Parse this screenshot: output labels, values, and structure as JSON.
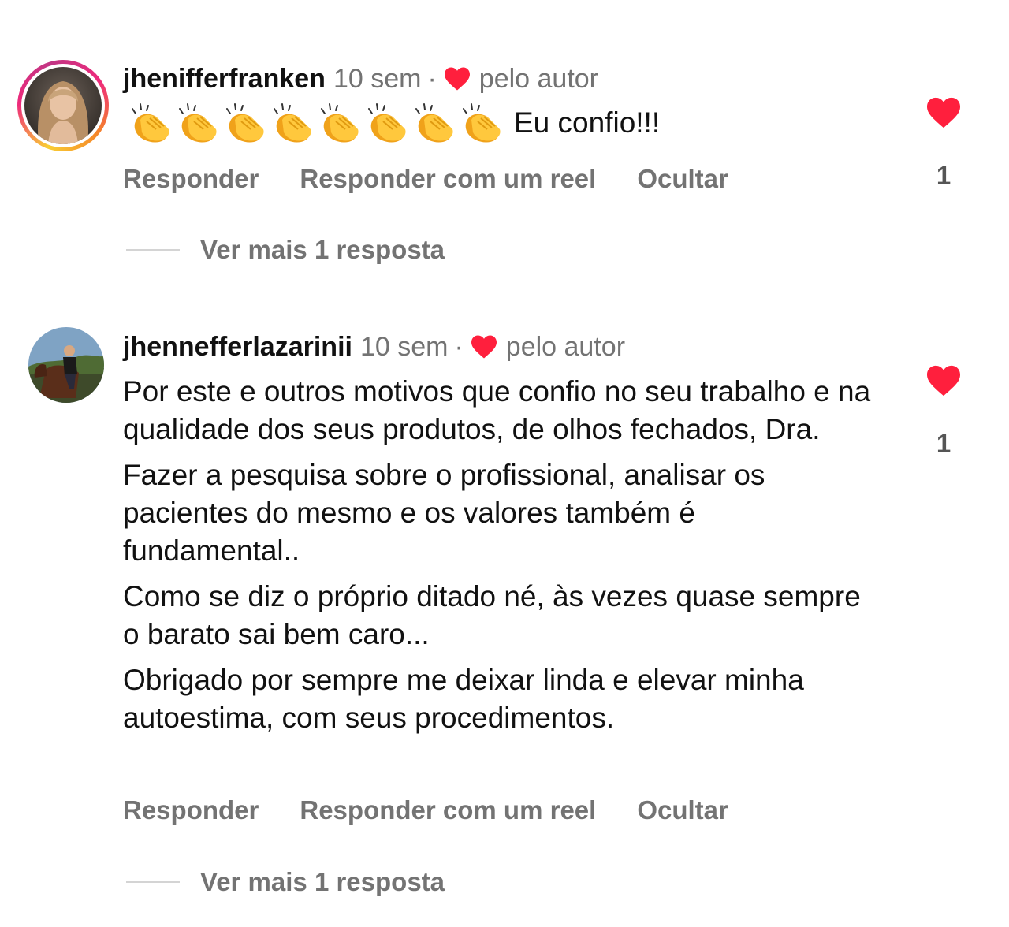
{
  "comments": [
    {
      "username": "jhenifferfranken",
      "time": "10 sem",
      "separator": "·",
      "liked_by_author": "pelo autor",
      "emoji_name": "clapping-hands",
      "emoji_count": 8,
      "text": "Eu confio!!!",
      "like_count": "1",
      "actions": {
        "reply": "Responder",
        "reply_reel": "Responder com um reel",
        "hide": "Ocultar"
      },
      "view_more": "Ver mais 1 resposta"
    },
    {
      "username": "jhennefferlazarinii",
      "time": "10 sem",
      "separator": "·",
      "liked_by_author": "pelo autor",
      "paragraphs": [
        "Por este e outros motivos que confio no seu trabalho e na qualidade dos seus produtos, de olhos fechados, Dra.",
        "Fazer a pesquisa sobre o profissional, analisar os pacientes do mesmo e os valores também é fundamental..",
        "Como se diz o próprio ditado né, às vezes quase sempre o barato sai bem caro...",
        "Obrigado por sempre me deixar linda e elevar minha autoestima, com seus procedimentos."
      ],
      "like_count": "1",
      "actions": {
        "reply": "Responder",
        "reply_reel": "Responder com um reel",
        "hide": "Ocultar"
      },
      "view_more": "Ver mais 1 resposta"
    }
  ],
  "colors": {
    "heart": "#ff1f3d",
    "muted": "#737373",
    "text": "#111111"
  }
}
